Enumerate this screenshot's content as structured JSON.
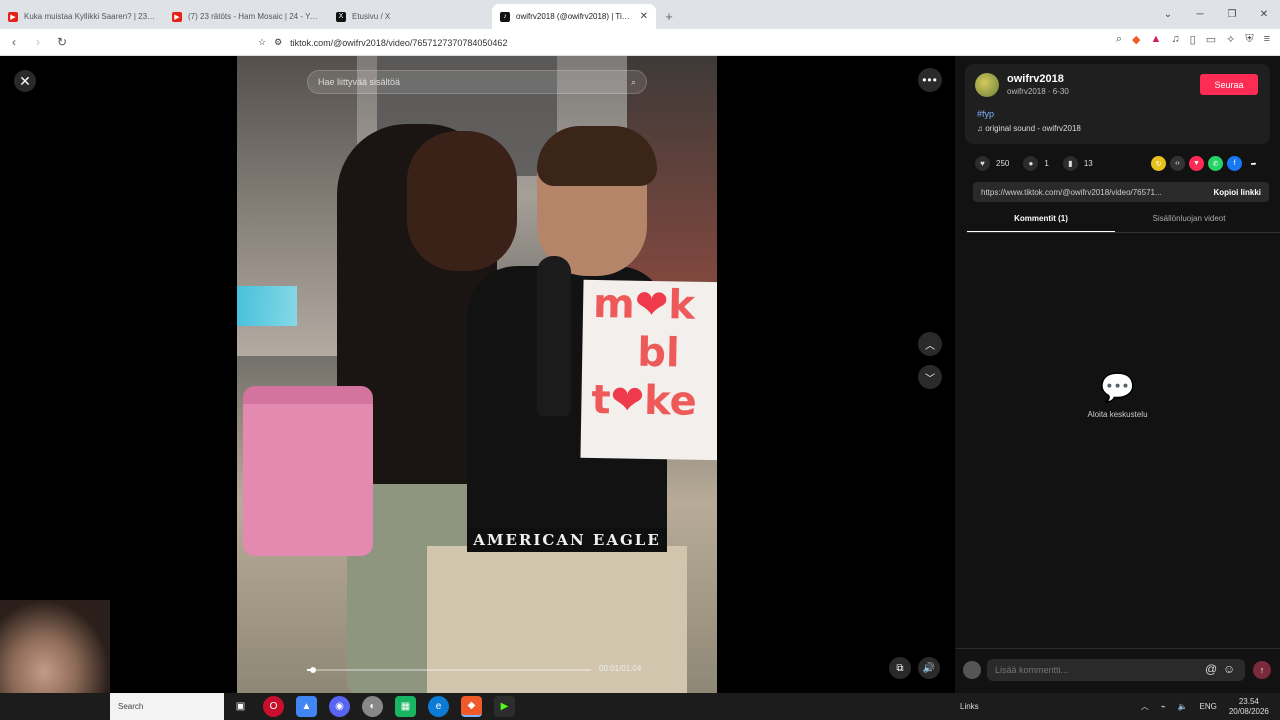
{
  "browser": {
    "tabs": [
      {
        "label": "Kuka muistaa Kyllikki Saaren? | 23 rikot...",
        "icon": "youtube-icon",
        "active": false
      },
      {
        "label": "(7) 23 rätöts - Ham Mosaic | 24 - YouTube",
        "icon": "youtube-icon",
        "active": false
      },
      {
        "label": "Etusivu / X",
        "icon": "x-icon",
        "active": false
      },
      {
        "label": "owifrv2018 (@owifrv2018) | TikTok",
        "icon": "tiktok-icon",
        "active": true
      }
    ],
    "new_tab": "+",
    "url": "tiktok.com/@owifrv2018/video/7657127370784050462"
  },
  "video": {
    "search_placeholder": "Hae liittyvää sisältöä",
    "waistband_text": "AMERICAN EAGLE",
    "placard_lines": [
      "m❤k",
      "bl",
      "t❤ke"
    ],
    "time": "00:01/01:04",
    "progress_fraction": 0.02
  },
  "panel": {
    "username": "owifrv2018",
    "meta": "owifrv2018 · 6-30",
    "follow_label": "Seuraa",
    "hashtag": "#fyp",
    "sound": "original sound - owifrv2018",
    "likes": "250",
    "comments": "1",
    "saves": "13",
    "link_url": "https://www.tiktok.com/@owifrv2018/video/76571...",
    "copy_link": "Kopioi linkki",
    "tabs": [
      {
        "label": "Kommentit (1)",
        "active": true
      },
      {
        "label": "Sisällönluojan videot",
        "active": false
      }
    ],
    "empty_label": "Aloita keskustelu",
    "comment_placeholder": "Lisää kommentti..."
  },
  "taskbar": {
    "search_label": "Search",
    "links_label": "Links",
    "lang": "ENG",
    "time": "23.54",
    "date": "20/08/2026"
  },
  "colors": {
    "accent": "#fe2c55",
    "hashtag": "#7fb3ff"
  }
}
